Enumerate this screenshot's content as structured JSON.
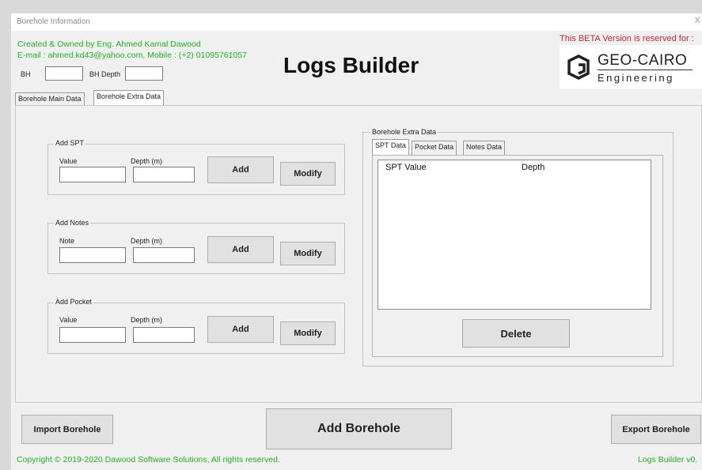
{
  "window": {
    "title": "Borehole Information",
    "close_label": "X"
  },
  "header": {
    "credit_line": "Created & Owned by Eng. Ahmed Kamal Dawood",
    "contact_line": "E-mail : ahmed.kd43@yahoo.com, Mobile : (+2) 01095761057",
    "app_title": "Logs Builder",
    "beta_notice": "This BETA Version is reserved for :",
    "logo_name": "GEO-CAIRO",
    "logo_sub": "Engineering",
    "logo_icon": "geo-cairo-g-logo"
  },
  "fields": {
    "bh_label": "BH",
    "bh_value": "",
    "bh_depth_label": "BH Depth",
    "bh_depth_value": ""
  },
  "main_tabs": [
    {
      "label": "Borehole Main Data",
      "active": false
    },
    {
      "label": "Borehole Extra Data",
      "active": true
    }
  ],
  "add_spt": {
    "title": "Add SPT",
    "value_label": "Value",
    "depth_label": "Depth (m)",
    "value": "",
    "depth": "",
    "add_label": "Add",
    "modify_label": "Modify"
  },
  "add_notes": {
    "title": "Add Notes",
    "note_label": "Note",
    "depth_label": "Depth (m)",
    "note": "",
    "depth": "",
    "add_label": "Add",
    "modify_label": "Modify"
  },
  "add_pocket": {
    "title": "Add Pocket",
    "value_label": "Value",
    "depth_label": "Depth (m)",
    "value": "",
    "depth": "",
    "add_label": "Add",
    "modify_label": "Modify"
  },
  "extra_data": {
    "title": "Borehole Extra Data",
    "tabs": [
      {
        "label": "SPT Data",
        "active": true
      },
      {
        "label": "Pocket Data",
        "active": false
      },
      {
        "label": "Notes Data",
        "active": false
      }
    ],
    "columns": [
      "SPT Value",
      "Depth"
    ],
    "rows": [],
    "delete_label": "Delete"
  },
  "footer": {
    "import_label": "Import Borehole",
    "add_borehole_label": "Add Borehole",
    "export_label": "Export Borehole",
    "copyright": "Copyright © 2019-2020 Dawood Software Solutions, All rights reserved.",
    "version": "Logs Builder v0."
  },
  "colors": {
    "credit_green": "#22b022",
    "beta_red": "#c0282d",
    "window_bg": "#f0f0f0"
  }
}
